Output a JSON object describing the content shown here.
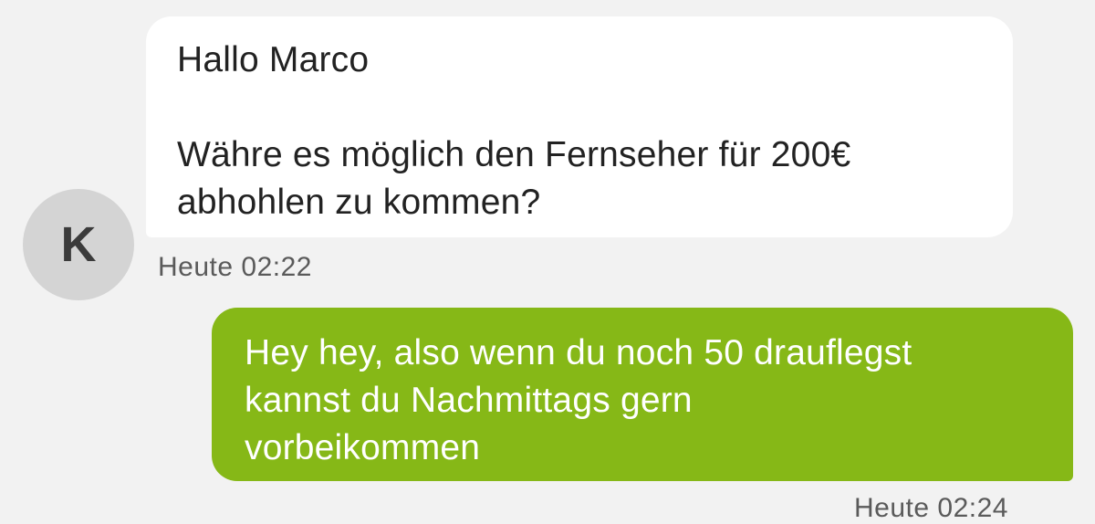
{
  "conversation": {
    "incoming": {
      "avatar_initial": "K",
      "lines": [
        "Hallo Marco",
        "",
        "Währe es möglich den Fernseher für 200€",
        "abhohlen zu kommen?"
      ],
      "timestamp": "Heute 02:22"
    },
    "outgoing": {
      "lines": [
        "Hey hey, also wenn du noch 50 drauflegst",
        "kannst du Nachmittags gern",
        "vorbeikommen"
      ],
      "timestamp": "Heute 02:24"
    }
  },
  "colors": {
    "background": "#f2f2f2",
    "incoming_bubble": "#ffffff",
    "outgoing_bubble": "#86b817",
    "avatar": "#d4d4d4"
  }
}
